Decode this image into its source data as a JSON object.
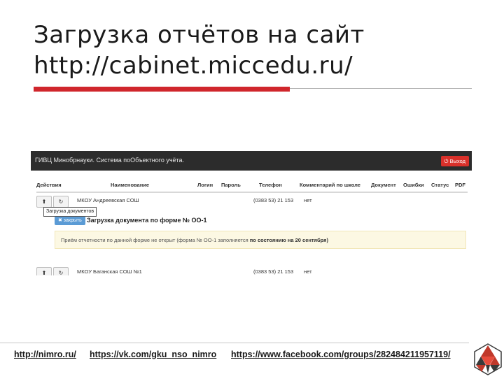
{
  "slide": {
    "title_line1": "Загрузка отчётов на сайт",
    "title_line2": "http://cabinet.miccedu.ru/"
  },
  "screenshot": {
    "nav_title": "ГИВЦ Минобрнауки. Система поОбъектного учёта.",
    "exit_label": "Выход",
    "columns": [
      "Действия",
      "Наименование",
      "Логин",
      "Пароль",
      "Телефон",
      "Комментарий по школе",
      "Документ",
      "Ошибки",
      "Статус",
      "PDF"
    ],
    "rows": [
      {
        "name": "МКОУ Андреевская СОШ",
        "phone": "(0383 53) 21 153",
        "comment": "нет"
      },
      {
        "name": "МКОУ Баганская СОШ №1",
        "phone": "(0383 53) 21 153",
        "comment": "нет"
      }
    ],
    "tooltip": "Загрузка документов",
    "close_label": "✖ закрыть",
    "upload_title": "Загрузка документа по форме № ОО-1",
    "notice_text": "Приём отчетности по данной форме не открыт (форма № ОО-1 заполняется",
    "notice_bold": "по состоянию на 20 сентября)"
  },
  "footer": {
    "link1": "http://nimro.ru/",
    "link2": "https://vk.com/gku_nso_nimro",
    "link3": "https://www.facebook.com/groups/282484211957119/"
  },
  "colors": {
    "accent_red": "#d0262c",
    "navbar": "#2c2c2c",
    "exit_button": "#d9302a",
    "close_button": "#5b9bd5",
    "notice_bg": "#fcf8e3",
    "logo_red": "#c0392b",
    "logo_dark": "#3a3a3a"
  },
  "icons": {
    "exit": "power-icon",
    "upload": "upload-icon",
    "refresh": "refresh-icon",
    "logo": "triangle-mosaic-logo"
  }
}
